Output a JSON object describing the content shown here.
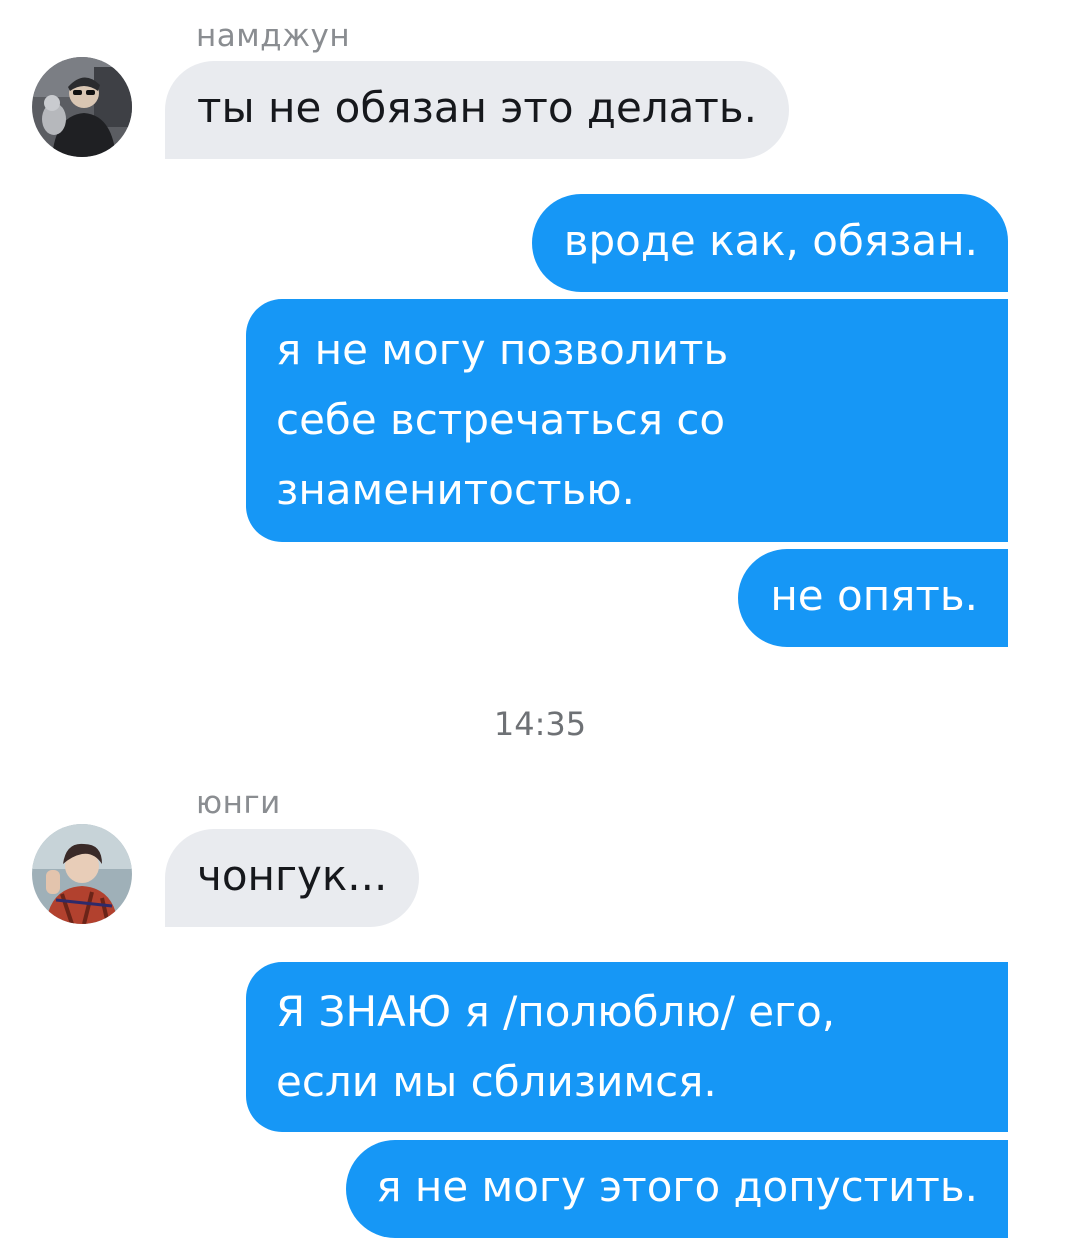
{
  "conversation": {
    "block1": {
      "sender": "намджун",
      "avatar_icon": "user-avatar-photo",
      "incoming": "ты не обязан это делать.",
      "outgoing": [
        "вроде как, обязан.",
        [
          "я не могу позволить",
          "себе встречаться со",
          "знаменитостью."
        ],
        "не опять."
      ]
    },
    "timestamp": "14:35",
    "block2": {
      "sender": "юнги",
      "avatar_icon": "user-avatar-photo",
      "incoming": "чонгук...",
      "outgoing": [
        [
          "Я ЗНАЮ я /полюблю/ его,",
          "если мы сблизимся."
        ],
        "я не могу этого допустить."
      ]
    }
  },
  "colors": {
    "outgoing_bubble": "#1697f6",
    "incoming_bubble": "#e9ebef",
    "background": "#ffffff"
  }
}
